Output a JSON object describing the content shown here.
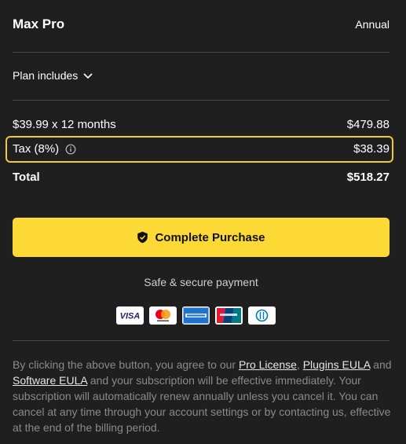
{
  "plan": {
    "name": "Max Pro",
    "term": "Annual"
  },
  "plan_includes_label": "Plan includes",
  "lines": {
    "subtotal_label": "$39.99 x 12 months",
    "subtotal_value": "$479.88",
    "tax_label": "Tax (8%)",
    "tax_value": "$38.39",
    "total_label": "Total",
    "total_value": "$518.27"
  },
  "cta": {
    "label": "Complete Purchase"
  },
  "secure_text": "Safe & secure payment",
  "cards": [
    "VISA",
    "Mastercard",
    "American Express",
    "UnionPay",
    "Diners Club"
  ],
  "legal": {
    "part1": "By clicking the above button, you agree to our ",
    "link1": "Pro License",
    "sep1": ", ",
    "link2": "Plugins EULA",
    "part2": " and ",
    "link3": "Software EULA",
    "part3": " and your subscription will be effective immediately. Your subscription will automatically renew annually unless you cancel it. You can cancel at any time through your account settings or by contacting us, effective at the end of the billing period."
  },
  "colors": {
    "accent": "#fdd935",
    "highlight_border": "#f0cc2a",
    "background": "#1f1f1f"
  }
}
